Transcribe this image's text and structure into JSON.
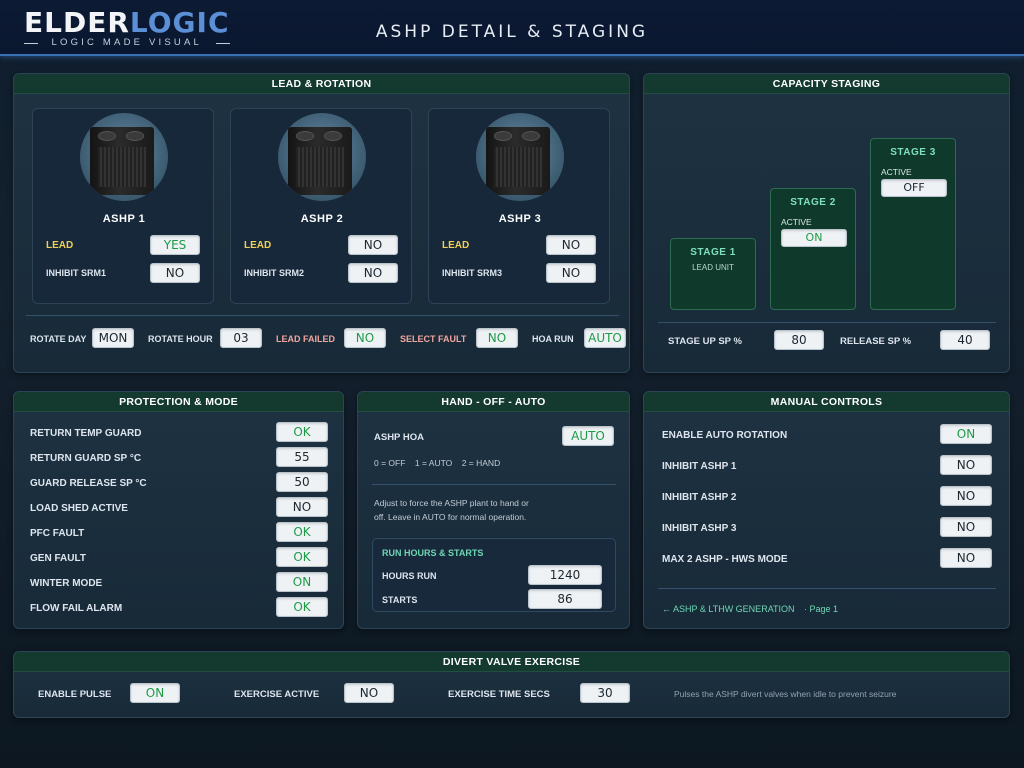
{
  "header": {
    "logo_part1": "ELDER",
    "logo_part2": "LOGIC",
    "logo_tagline": "LOGIC MADE VISUAL",
    "title": "ASHP DETAIL & STAGING"
  },
  "lead_rotation": {
    "title": "LEAD & ROTATION",
    "units": [
      {
        "name": "ASHP 1",
        "lead_label": "LEAD",
        "lead_value": "YES",
        "inhibit_label": "INHIBIT SRM1",
        "inhibit_value": "NO"
      },
      {
        "name": "ASHP 2",
        "lead_label": "LEAD",
        "lead_value": "NO",
        "inhibit_label": "INHIBIT SRM2",
        "inhibit_value": "NO"
      },
      {
        "name": "ASHP 3",
        "lead_label": "LEAD",
        "lead_value": "NO",
        "inhibit_label": "INHIBIT SRM3",
        "inhibit_value": "NO"
      }
    ],
    "rotate_day_label": "ROTATE DAY",
    "rotate_day_value": "MON",
    "rotate_hour_label": "ROTATE HOUR",
    "rotate_hour_value": "03",
    "lead_failed_label": "LEAD FAILED",
    "lead_failed_value": "NO",
    "select_fault_label": "SELECT FAULT",
    "select_fault_value": "NO",
    "hoa_run_label": "HOA RUN",
    "hoa_run_value": "AUTO"
  },
  "capacity": {
    "title": "CAPACITY STAGING",
    "stage1": {
      "title": "STAGE 1",
      "sub": "LEAD UNIT"
    },
    "stage2": {
      "title": "STAGE 2",
      "active_label": "ACTIVE",
      "active_value": "ON"
    },
    "stage3": {
      "title": "STAGE 3",
      "active_label": "ACTIVE",
      "active_value": "OFF"
    },
    "stage_up_label": "STAGE UP SP %",
    "stage_up_value": "80",
    "release_label": "RELEASE SP %",
    "release_value": "40"
  },
  "protection": {
    "title": "PROTECTION & MODE",
    "rows": [
      {
        "label": "RETURN TEMP GUARD",
        "value": "OK"
      },
      {
        "label": "RETURN GUARD SP °C",
        "value": "55"
      },
      {
        "label": "GUARD RELEASE SP °C",
        "value": "50"
      },
      {
        "label": "LOAD SHED ACTIVE",
        "value": "NO"
      },
      {
        "label": "PFC FAULT",
        "value": "OK"
      },
      {
        "label": "GEN FAULT",
        "value": "OK"
      },
      {
        "label": "WINTER MODE",
        "value": "ON"
      },
      {
        "label": "FLOW FAIL ALARM",
        "value": "OK"
      }
    ]
  },
  "hoa": {
    "title": "HAND - OFF - AUTO",
    "ashp_hoa_label": "ASHP HOA",
    "ashp_hoa_value": "AUTO",
    "legend": "0 = OFF    1 = AUTO    2 = HAND",
    "note_line1": "Adjust to force the ASHP plant to hand or",
    "note_line2": "off. Leave in AUTO for normal operation.",
    "run_title": "RUN HOURS & STARTS",
    "hours_label": "HOURS RUN",
    "hours_value": "1240",
    "starts_label": "STARTS",
    "starts_value": "86"
  },
  "manual": {
    "title": "MANUAL CONTROLS",
    "rows": [
      {
        "label": "ENABLE AUTO ROTATION",
        "value": "ON"
      },
      {
        "label": "INHIBIT ASHP 1",
        "value": "NO"
      },
      {
        "label": "INHIBIT ASHP 2",
        "value": "NO"
      },
      {
        "label": "INHIBIT ASHP 3",
        "value": "NO"
      },
      {
        "label": "MAX 2 ASHP - HWS MODE",
        "value": "NO"
      }
    ],
    "nav_link": "← ASHP & LTHW GENERATION",
    "nav_page": "·  Page 1"
  },
  "divert": {
    "title": "DIVERT VALVE EXERCISE",
    "enable_label": "ENABLE PULSE",
    "enable_value": "ON",
    "active_label": "EXERCISE ACTIVE",
    "active_value": "NO",
    "time_label": "EXERCISE TIME SECS",
    "time_value": "30",
    "note": "Pulses the ASHP divert valves when idle to prevent seizure"
  },
  "colors": {
    "accent_green": "#1e9a47",
    "header_green": "#143a30",
    "lead_yellow": "#f0cf55",
    "fault_pink": "#f1a6a0"
  }
}
